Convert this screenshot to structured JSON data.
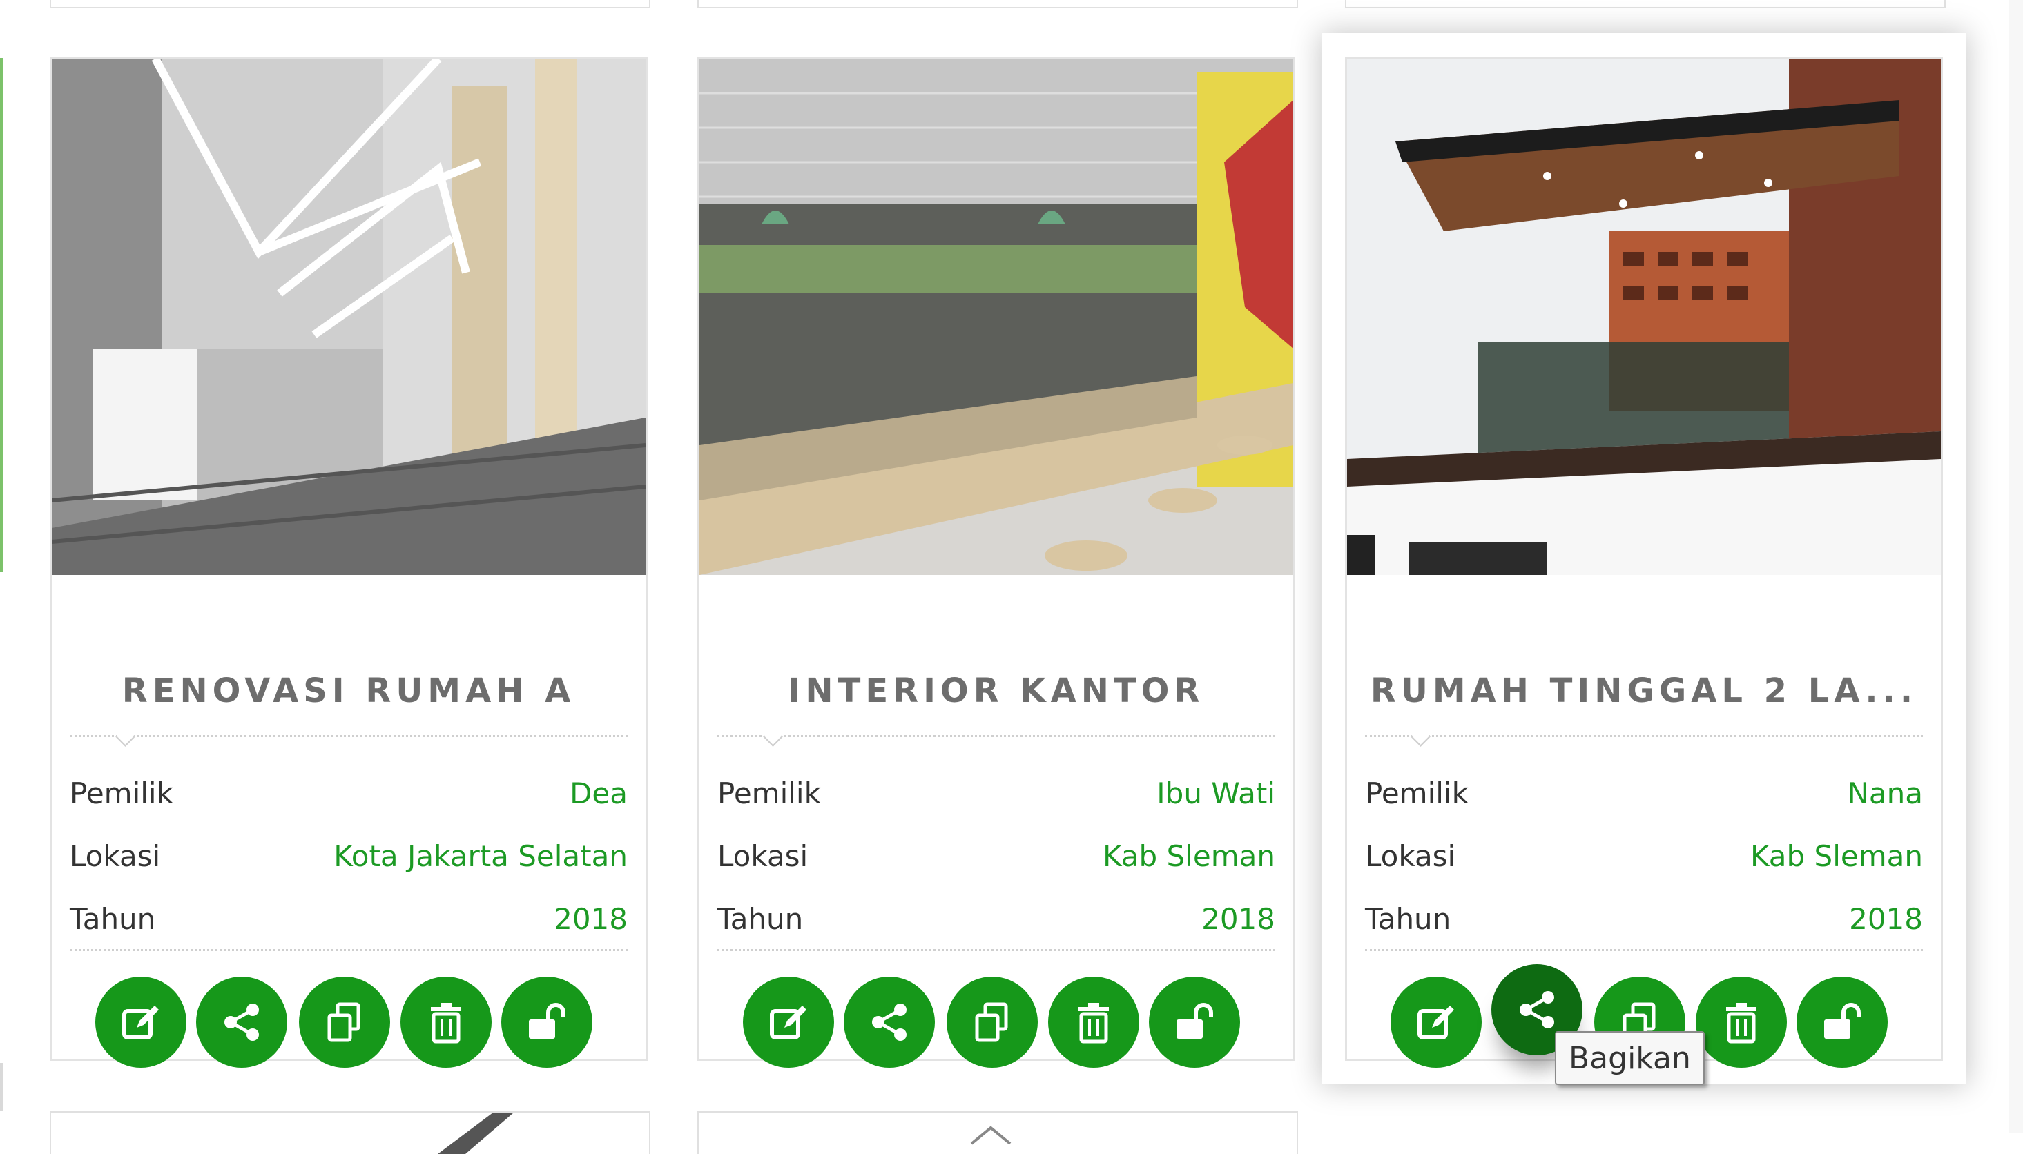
{
  "cards": [
    {
      "title": "RENOVASI RUMAH A",
      "rows": [
        {
          "label": "Pemilik",
          "value": "Dea"
        },
        {
          "label": "Lokasi",
          "value": "Kota Jakarta Selatan"
        },
        {
          "label": "Tahun",
          "value": "2018"
        }
      ]
    },
    {
      "title": "INTERIOR KANTOR",
      "rows": [
        {
          "label": "Pemilik",
          "value": "Ibu Wati"
        },
        {
          "label": "Lokasi",
          "value": "Kab Sleman"
        },
        {
          "label": "Tahun",
          "value": "2018"
        }
      ]
    },
    {
      "title": "RUMAH TINGGAL 2 LA...",
      "rows": [
        {
          "label": "Pemilik",
          "value": "Nana"
        },
        {
          "label": "Lokasi",
          "value": "Kab Sleman"
        },
        {
          "label": "Tahun",
          "value": "2018"
        }
      ]
    }
  ],
  "actions": [
    "edit-icon",
    "share-icon",
    "copy-icon",
    "trash-icon",
    "unlock-icon"
  ],
  "tooltip": "Bagikan",
  "colors": {
    "accent": "#16981a",
    "accent_active": "#0e6b12",
    "value_text": "#1c9a24",
    "title_text": "#6d6d6d"
  }
}
